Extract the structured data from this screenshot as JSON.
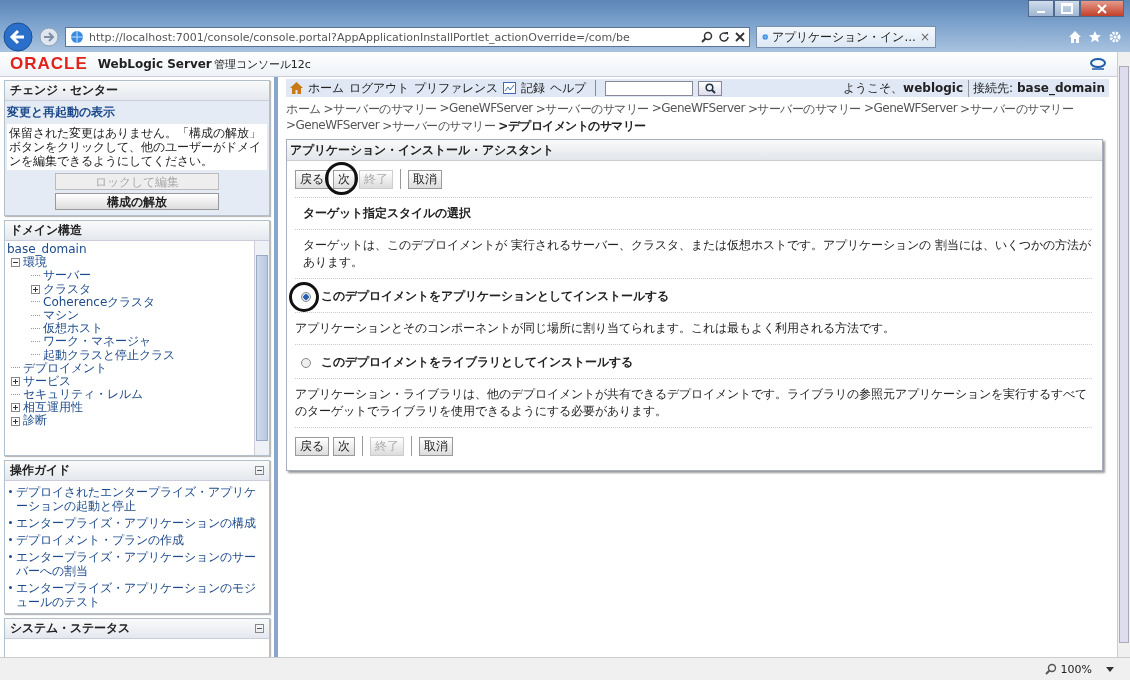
{
  "browser": {
    "address": "http://localhost:7001/console/console.portal?AppApplicationInstallPortlet_actionOverride=/com/be",
    "tab": {
      "title": "アプリケーション・イン...",
      "close": "×"
    },
    "zoom": "100%"
  },
  "header": {
    "brand": "ORACLE",
    "product": "WebLogic Server",
    "subtitle": "管理コンソール12c"
  },
  "toolbar": {
    "links": [
      "ホーム",
      "ログアウト",
      "プリファレンス",
      "記録",
      "ヘルプ"
    ],
    "welcome": "ようこそ、**weblogic**",
    "connected": "接続先: **base_domain**"
  },
  "change_center": {
    "title": "チェンジ・センター",
    "link": "変更と再起動の表示",
    "message": "保留された変更はありません。「構成の解放」ボタンをクリックして、他のユーザーがドメインを編集できるようにしてください。",
    "buttons": [
      {
        "label": "ロックして編集",
        "disabled": true
      },
      {
        "label": "構成の解放",
        "disabled": false
      }
    ]
  },
  "domain_structure": {
    "title": "ドメイン構造",
    "root": "base_domain",
    "tree": [
      {
        "label": "環境",
        "expanded": true,
        "children": [
          {
            "label": "サーバー"
          },
          {
            "label": "クラスタ",
            "expanded": false
          },
          {
            "label": "Coherenceクラスタ"
          },
          {
            "label": "マシン"
          },
          {
            "label": "仮想ホスト"
          },
          {
            "label": "ワーク・マネージャ"
          },
          {
            "label": "起動クラスと停止クラス"
          }
        ]
      },
      {
        "label": "デプロイメント"
      },
      {
        "label": "サービス",
        "expanded": false
      },
      {
        "label": "セキュリティ・レルム"
      },
      {
        "label": "相互運用性",
        "expanded": false
      },
      {
        "label": "診断",
        "expanded": false
      }
    ]
  },
  "how_do_i": {
    "title": "操作ガイド",
    "links": [
      "デプロイされたエンタープライズ・アプリケーションの起動と停止",
      "エンタープライズ・アプリケーションの構成",
      "デプロイメント・プランの作成",
      "エンタープライズ・アプリケーションのサーバーへの割当",
      "エンタープライズ・アプリケーションのモジュールのテスト"
    ]
  },
  "system_status": {
    "title": "システム・ステータス"
  },
  "breadcrumb": [
    {
      "label": "ホーム",
      "current": false
    },
    {
      "label": ">サーバーのサマリー",
      "current": false
    },
    {
      "label": ">GeneWFServer",
      "current": false
    },
    {
      "label": ">サーバーのサマリー",
      "current": false
    },
    {
      "label": ">GeneWFServer",
      "current": false
    },
    {
      "label": ">サーバーのサマリー",
      "current": false
    },
    {
      "label": ">GeneWFServer",
      "current": false
    },
    {
      "label": ">サーバーのサマリー",
      "current": false
    },
    {
      "label": ">GeneWFServer",
      "current": false
    },
    {
      "label": ">サーバーのサマリー",
      "current": false
    },
    {
      "label": ">デプロイメントのサマリー",
      "current": true
    }
  ],
  "assistant": {
    "title": "アプリケーション・インストール・アシスタント",
    "buttons_top": [
      {
        "label": "戻る",
        "disabled": false,
        "circled": false
      },
      {
        "label": "次",
        "disabled": false,
        "circled": true
      },
      {
        "label": "終了",
        "disabled": true,
        "circled": false
      },
      {
        "label": "取消",
        "disabled": false,
        "circled": false
      }
    ],
    "heading": "ターゲット指定スタイルの選択",
    "intro": "ターゲットは、このデプロイメントが 実行されるサーバー、クラスタ、または仮想ホストです。アプリケーションの 割当には、いくつかの方法があります。",
    "options": [
      {
        "label": "このデプロイメントをアプリケーションとしてインストールする",
        "selected": true,
        "circled": true,
        "description": "アプリケーションとそのコンポーネントが同じ場所に割り当てられます。これは最もよく利用される方法です。"
      },
      {
        "label": "このデプロイメントをライブラリとしてインストールする",
        "selected": false,
        "circled": false,
        "description": "アプリケーション・ライブラリは、他のデプロイメントが共有できるデプロイメントです。ライブラリの参照元アプリケーションを実行するすべてのターゲットでライブラリを使用できるようにする必要があります。"
      }
    ],
    "buttons_bottom": [
      {
        "label": "戻る",
        "disabled": false,
        "circled": false
      },
      {
        "label": "次",
        "disabled": false,
        "circled": false
      },
      {
        "label": "終了",
        "disabled": true,
        "circled": false
      },
      {
        "label": "取消",
        "disabled": false,
        "circled": false
      }
    ]
  }
}
